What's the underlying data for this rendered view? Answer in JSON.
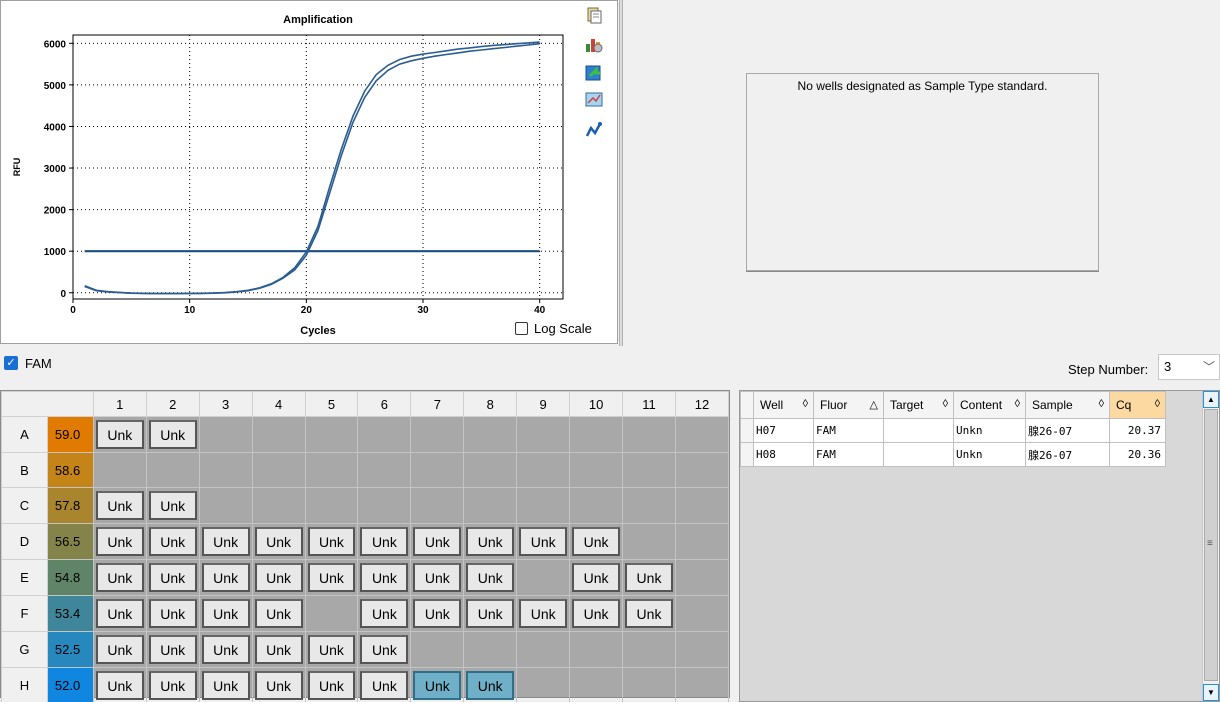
{
  "chart": {
    "title": "Amplification",
    "xlabel": "Cycles",
    "ylabel": "RFU",
    "log_scale_label": "Log Scale",
    "log_scale_checked": false
  },
  "chart_data": {
    "type": "line",
    "title": "Amplification",
    "xlabel": "Cycles",
    "ylabel": "RFU",
    "xlim": [
      0,
      42
    ],
    "ylim": [
      -150,
      6200
    ],
    "x_ticks": [
      0,
      10,
      20,
      30,
      40
    ],
    "y_ticks": [
      0,
      1000,
      2000,
      3000,
      4000,
      5000,
      6000
    ],
    "grid": true,
    "threshold": 1000,
    "series": [
      {
        "x": [
          1,
          2,
          3,
          4,
          5,
          6,
          7,
          8,
          9,
          10,
          11,
          12,
          13,
          14,
          15,
          16,
          17,
          18,
          19,
          20,
          21,
          22,
          23,
          24,
          25,
          26,
          27,
          28,
          29,
          30,
          31,
          32,
          33,
          34,
          35,
          36,
          37,
          38,
          39,
          40
        ],
        "values": [
          150,
          50,
          20,
          5,
          -10,
          -15,
          -20,
          -20,
          -20,
          -18,
          -15,
          -10,
          0,
          20,
          50,
          110,
          200,
          350,
          550,
          900,
          1500,
          2400,
          3300,
          4100,
          4700,
          5100,
          5350,
          5500,
          5580,
          5640,
          5690,
          5730,
          5770,
          5810,
          5840,
          5870,
          5900,
          5930,
          5960,
          5990
        ]
      },
      {
        "x": [
          1,
          2,
          3,
          4,
          5,
          6,
          7,
          8,
          9,
          10,
          11,
          12,
          13,
          14,
          15,
          16,
          17,
          18,
          19,
          20,
          21,
          22,
          23,
          24,
          25,
          26,
          27,
          28,
          29,
          30,
          31,
          32,
          33,
          34,
          35,
          36,
          37,
          38,
          39,
          40
        ],
        "values": [
          170,
          60,
          25,
          8,
          -8,
          -14,
          -18,
          -18,
          -18,
          -16,
          -13,
          -8,
          5,
          25,
          60,
          120,
          215,
          370,
          600,
          980,
          1600,
          2550,
          3450,
          4250,
          4850,
          5250,
          5470,
          5610,
          5690,
          5740,
          5780,
          5820,
          5860,
          5890,
          5920,
          5950,
          5970,
          5990,
          6010,
          6030
        ]
      }
    ]
  },
  "standard_panel": {
    "message": "No wells designated as Sample Type standard."
  },
  "fluor_bar": {
    "fluor": "FAM",
    "checked": true,
    "step_label": "Step Number:",
    "step_value": "3"
  },
  "plate": {
    "columns": [
      "1",
      "2",
      "3",
      "4",
      "5",
      "6",
      "7",
      "8",
      "9",
      "10",
      "11",
      "12"
    ],
    "rows": [
      {
        "label": "A",
        "temp": "59.0",
        "color": "#e07b00",
        "wells": [
          "Unk",
          "Unk",
          "",
          "",
          "",
          "",
          "",
          "",
          "",
          "",
          "",
          ""
        ]
      },
      {
        "label": "B",
        "temp": "58.6",
        "color": "#c48418",
        "wells": [
          "",
          "",
          "",
          "",
          "",
          "",
          "",
          "",
          "",
          "",
          "",
          ""
        ]
      },
      {
        "label": "C",
        "temp": "57.8",
        "color": "#a9862e",
        "wells": [
          "Unk",
          "Unk",
          "",
          "",
          "",
          "",
          "",
          "",
          "",
          "",
          "",
          ""
        ]
      },
      {
        "label": "D",
        "temp": "56.5",
        "color": "#84844a",
        "wells": [
          "Unk",
          "Unk",
          "Unk",
          "Unk",
          "Unk",
          "Unk",
          "Unk",
          "Unk",
          "Unk",
          "Unk",
          "",
          ""
        ]
      },
      {
        "label": "E",
        "temp": "54.8",
        "color": "#5f8468",
        "wells": [
          "Unk",
          "Unk",
          "Unk",
          "Unk",
          "Unk",
          "Unk",
          "Unk",
          "Unk",
          "",
          "Unk",
          "Unk",
          ""
        ]
      },
      {
        "label": "F",
        "temp": "53.4",
        "color": "#3f869a",
        "wells": [
          "Unk",
          "Unk",
          "Unk",
          "Unk",
          "",
          "Unk",
          "Unk",
          "Unk",
          "Unk",
          "Unk",
          "Unk",
          ""
        ]
      },
      {
        "label": "G",
        "temp": "52.5",
        "color": "#2788be",
        "wells": [
          "Unk",
          "Unk",
          "Unk",
          "Unk",
          "Unk",
          "Unk",
          "",
          "",
          "",
          "",
          "",
          ""
        ]
      },
      {
        "label": "H",
        "temp": "52.0",
        "color": "#0f86e0",
        "wells": [
          "Unk",
          "Unk",
          "Unk",
          "Unk",
          "Unk",
          "Unk",
          "Unk",
          "Unk",
          "",
          "",
          "",
          ""
        ],
        "selected": [
          6,
          7
        ]
      }
    ]
  },
  "well_grid": {
    "headers": [
      {
        "label": "Well",
        "sort": "◊"
      },
      {
        "label": "Fluor",
        "sort": "△"
      },
      {
        "label": "Target",
        "sort": "◊"
      },
      {
        "label": "Content",
        "sort": "◊"
      },
      {
        "label": "Sample",
        "sort": "◊"
      },
      {
        "label": "Cq",
        "sort": "◊"
      }
    ],
    "rows": [
      [
        "H07",
        "FAM",
        "",
        "Unkn",
        "腺26-07",
        "20.37"
      ],
      [
        "H08",
        "FAM",
        "",
        "Unkn",
        "腺26-07",
        "20.36"
      ]
    ]
  }
}
